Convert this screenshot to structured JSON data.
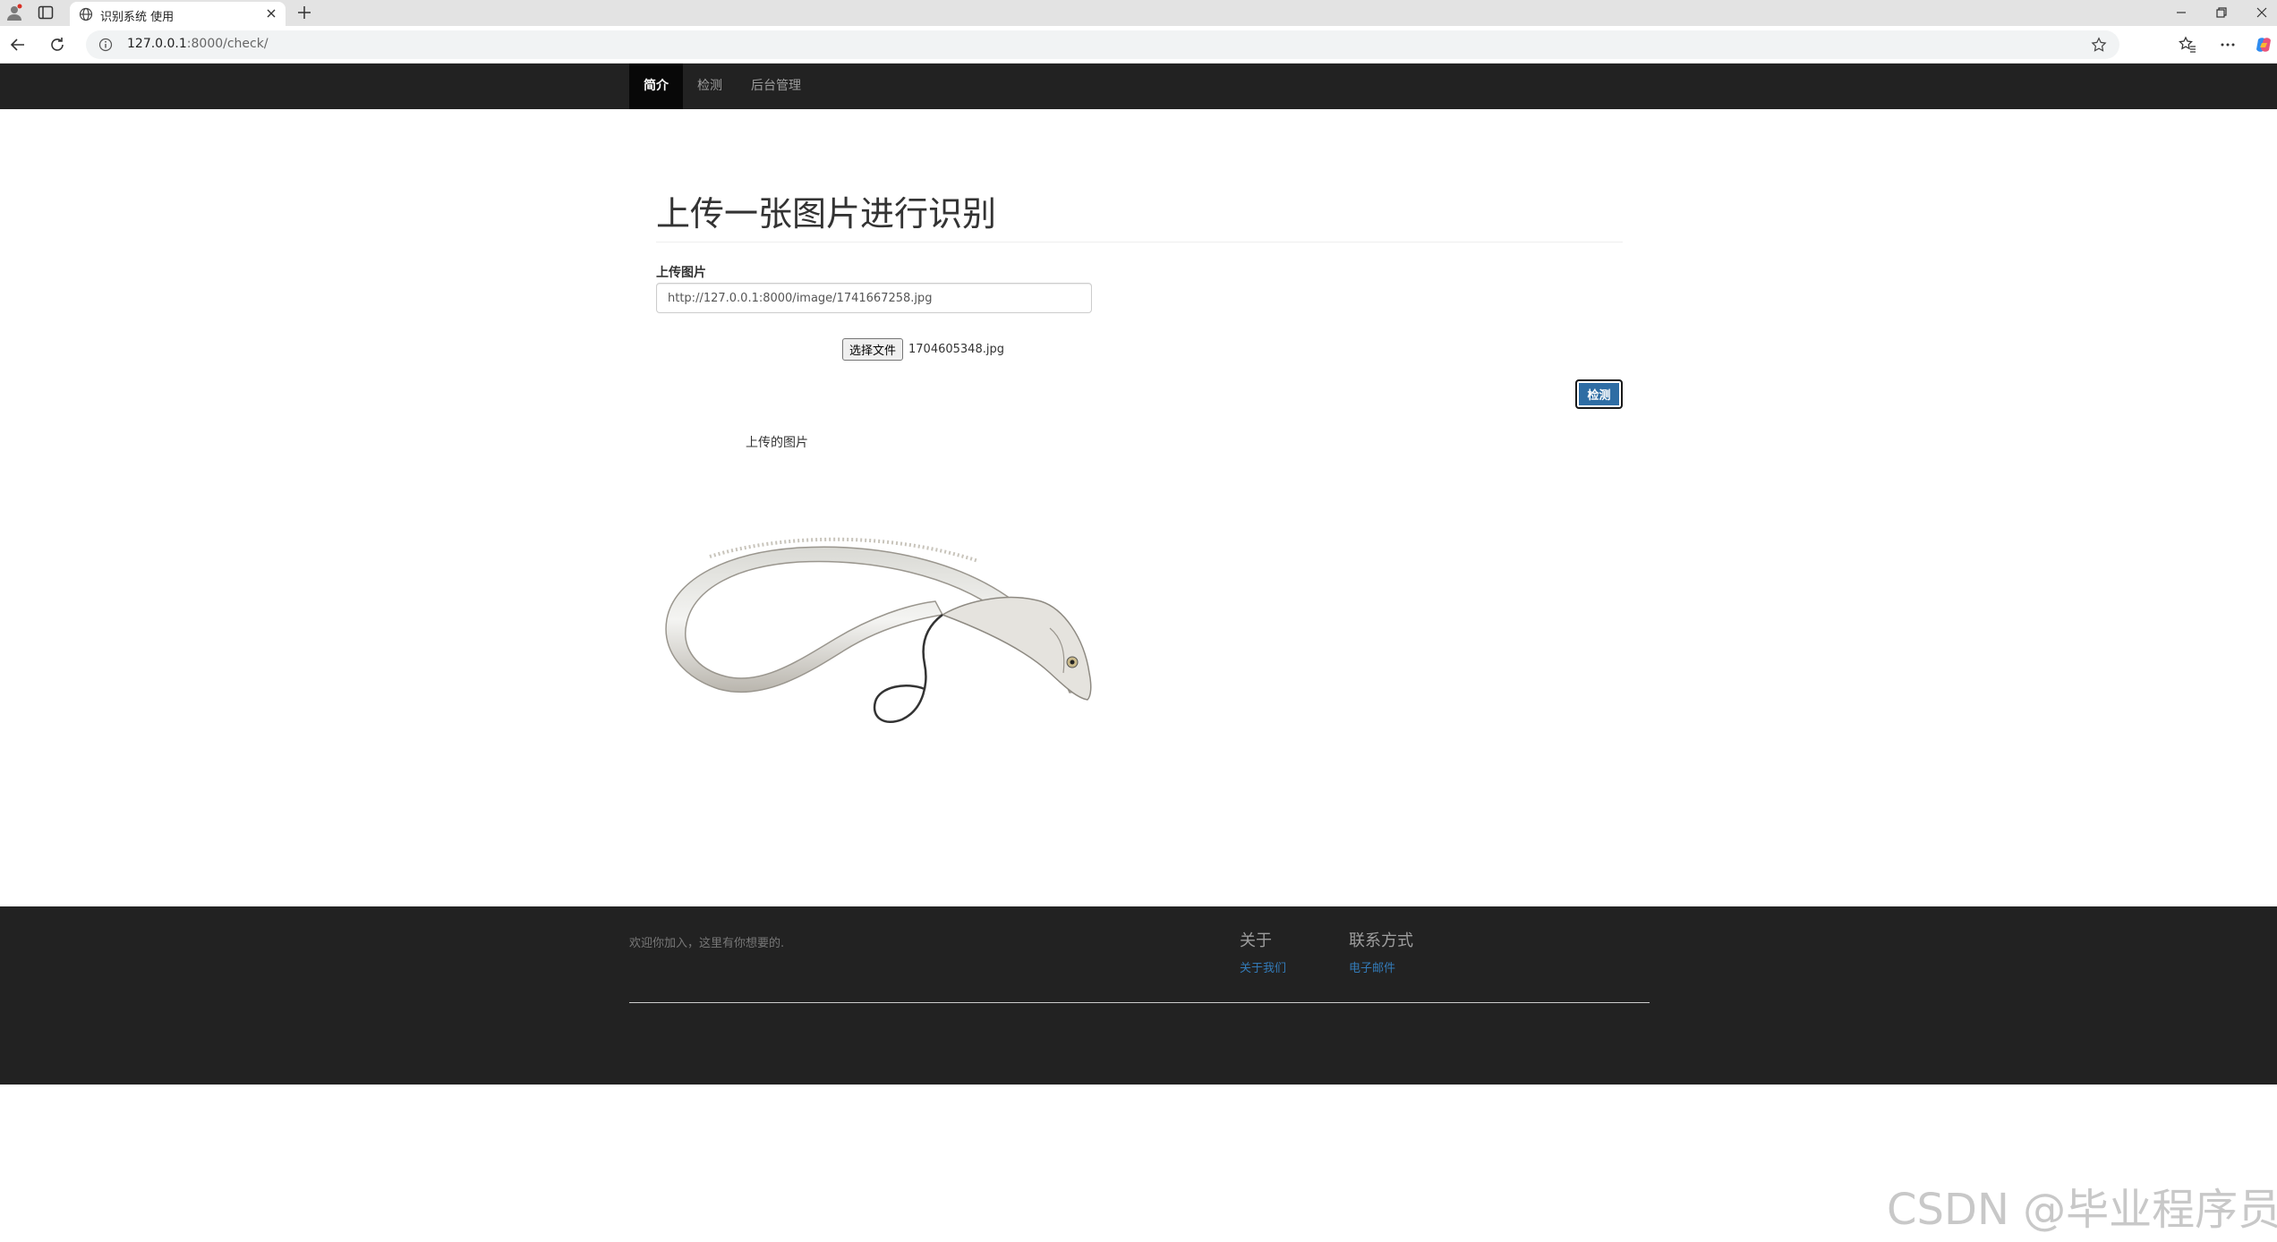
{
  "browser": {
    "tab_title": "识别系统 使用",
    "url_host": "127.0.0.1",
    "url_rest": ":8000/check/"
  },
  "nav": {
    "items": [
      {
        "label": "简介",
        "active": true
      },
      {
        "label": "检测",
        "active": false
      },
      {
        "label": "后台管理",
        "active": false
      }
    ]
  },
  "main": {
    "title": "上传一张图片进行识别",
    "upload_label": "上传图片",
    "image_url_value": "http://127.0.0.1:8000/image/1741667258.jpg",
    "file_button_label": "选择文件",
    "file_name": "1704605348.jpg",
    "detect_button_label": "检测",
    "uploaded_caption": "上传的图片"
  },
  "footer": {
    "welcome": "欢迎你加入，这里有你想要的.",
    "about_heading": "关于",
    "about_link": "关于我们",
    "contact_heading": "联系方式",
    "contact_link": "电子邮件"
  },
  "watermark": "CSDN @毕业程序员",
  "colors": {
    "navbar_bg": "#222222",
    "nav_active_bg": "#080808",
    "primary_button": "#2e6da4",
    "link": "#337ab7"
  }
}
